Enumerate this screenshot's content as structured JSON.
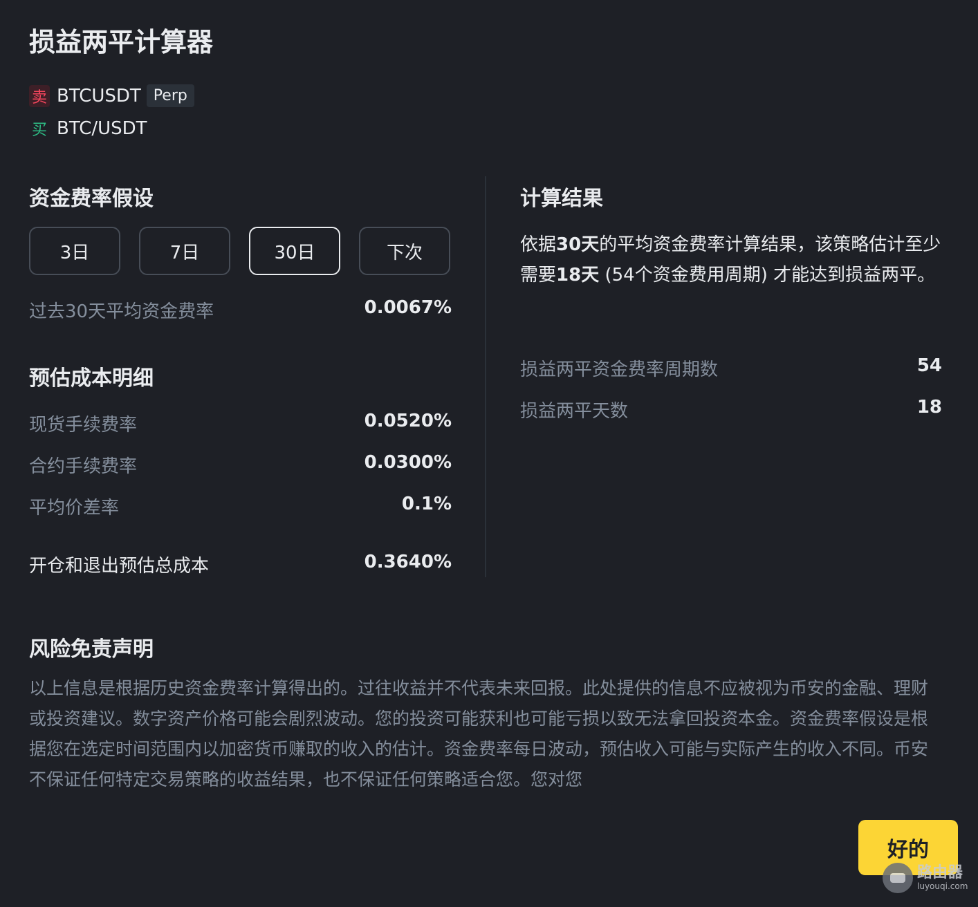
{
  "title": "损益两平计算器",
  "pairs": {
    "sell": {
      "side": "卖",
      "name": "BTCUSDT",
      "tag": "Perp"
    },
    "buy": {
      "side": "买",
      "name": "BTC/USDT"
    }
  },
  "funding": {
    "title": "资金费率假设",
    "periods": [
      "3日",
      "7日",
      "30日",
      "下次"
    ],
    "selected_period": "30日",
    "avg_label": "过去30天平均资金费率",
    "avg_value": "0.0067%"
  },
  "costs": {
    "title": "预估成本明细",
    "rows": [
      {
        "label": "现货手续费率",
        "value": "0.0520%"
      },
      {
        "label": "合约手续费率",
        "value": "0.0300%"
      },
      {
        "label": "平均价差率",
        "value": "0.1%"
      }
    ],
    "total_label": "开仓和退出预估总成本",
    "total_value": "0.3640%"
  },
  "result": {
    "title": "计算结果",
    "text_1": "依据",
    "text_2": "30天",
    "text_3": "的平均资金费率计算结果，该策略估计至少需要",
    "text_4": "18天",
    "text_5": " (54个资金费用周期) 才能达到损益两平。",
    "rows": [
      {
        "label": "损益两平资金费率周期数",
        "value": "54"
      },
      {
        "label": "损益两平天数",
        "value": "18"
      }
    ]
  },
  "disclaimer": {
    "title": "风险免责声明",
    "text": "以上信息是根据历史资金费率计算得出的。过往收益并不代表未来回报。此处提供的信息不应被视为币安的金融、理财或投资建议。数字资产价格可能会剧烈波动。您的投资可能获利也可能亏损以致无法拿回投资本金。资金费率假设是根据您在选定时间范围内以加密货币赚取的收入的估计。资金费率每日波动，预估收入可能与实际产生的收入不同。币安不保证任何特定交易策略的收益结果，也不保证任何策略适合您。您对您"
  },
  "ok_label": "好的",
  "watermark": {
    "main": "路由器",
    "sub": "luyouqi.com"
  },
  "colors": {
    "accent": "#fcd535",
    "sell": "#f6465d",
    "buy": "#2ebd85",
    "background": "#1e2026"
  }
}
